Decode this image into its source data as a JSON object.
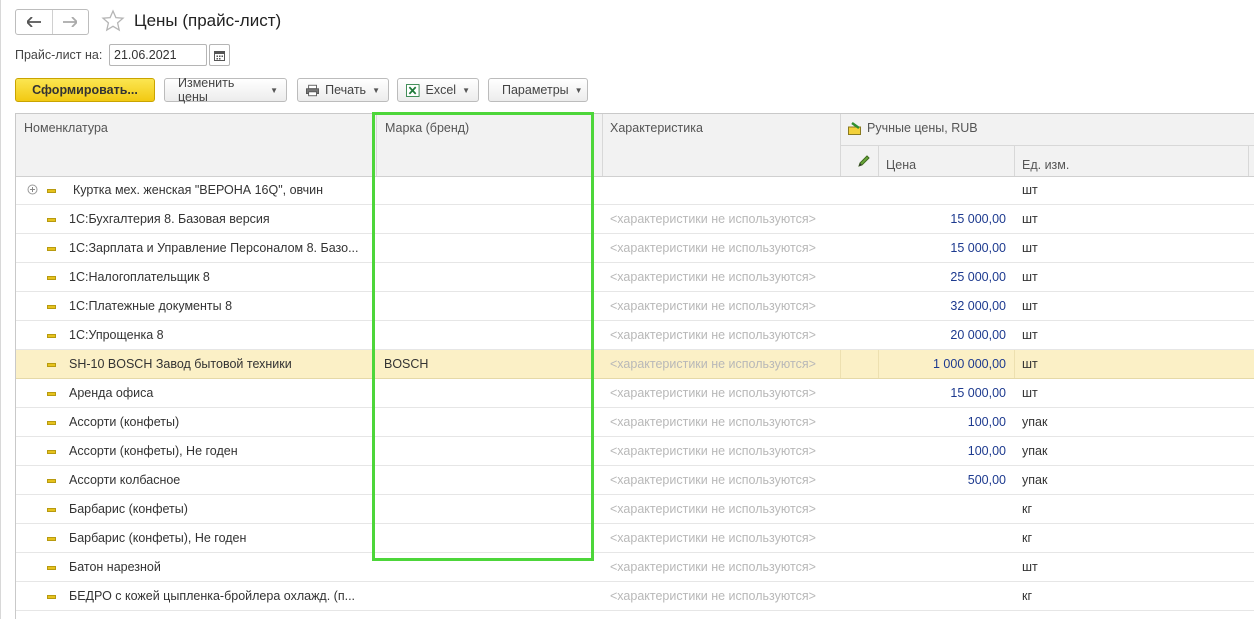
{
  "header": {
    "title": "Цены (прайс-лист)"
  },
  "filter": {
    "date_label": "Прайс-лист на:",
    "date_value": "21.06.2021"
  },
  "toolbar": {
    "generate_label": "Сформировать...",
    "change_prices_label": "Изменить цены",
    "print_label": "Печать",
    "excel_label": "Excel",
    "params_label": "Параметры"
  },
  "table": {
    "columns": {
      "name": "Номенклатура",
      "brand": "Марка (бренд)",
      "characteristic": "Характеристика",
      "manual_prices": "Ручные цены, RUB",
      "price": "Цена",
      "unit": "Ед. изм."
    },
    "rows": [
      {
        "name": "Куртка мех. женская \"ВЕРОНА 16Q\", овчин",
        "brand": "",
        "characteristic": "",
        "price": "",
        "unit": "шт"
      },
      {
        "name": "1С:Бухгалтерия 8. Базовая версия",
        "brand": "",
        "characteristic": "<характеристики не используются>",
        "price": "15 000,00",
        "unit": "шт"
      },
      {
        "name": "1С:Зарплата и Управление Персоналом 8. Базо...",
        "brand": "",
        "characteristic": "<характеристики не используются>",
        "price": "15 000,00",
        "unit": "шт"
      },
      {
        "name": "1С:Налогоплательщик 8",
        "brand": "",
        "characteristic": "<характеристики не используются>",
        "price": "25 000,00",
        "unit": "шт"
      },
      {
        "name": "1С:Платежные документы 8",
        "brand": "",
        "characteristic": "<характеристики не используются>",
        "price": "32 000,00",
        "unit": "шт"
      },
      {
        "name": "1С:Упрощенка 8",
        "brand": "",
        "characteristic": "<характеристики не используются>",
        "price": "20 000,00",
        "unit": "шт"
      },
      {
        "name": "SH-10 BOSCH Завод бытовой техники",
        "brand": "BOSCH",
        "characteristic": "<характеристики не используются>",
        "price": "1 000 000,00",
        "unit": "шт"
      },
      {
        "name": "Аренда офиса",
        "brand": "",
        "characteristic": "<характеристики не используются>",
        "price": "15 000,00",
        "unit": "шт"
      },
      {
        "name": "Ассорти (конфеты)",
        "brand": "",
        "characteristic": "<характеристики не используются>",
        "price": "100,00",
        "unit": "упак"
      },
      {
        "name": "Ассорти (конфеты), Не годен",
        "brand": "",
        "characteristic": "<характеристики не используются>",
        "price": "100,00",
        "unit": "упак"
      },
      {
        "name": "Ассорти колбасное",
        "brand": "",
        "characteristic": "<характеристики не используются>",
        "price": "500,00",
        "unit": "упак"
      },
      {
        "name": "Барбарис (конфеты)",
        "brand": "",
        "characteristic": "<характеристики не используются>",
        "price": "",
        "unit": "кг"
      },
      {
        "name": "Барбарис (конфеты), Не годен",
        "brand": "",
        "characteristic": "<характеристики не используются>",
        "price": "",
        "unit": "кг"
      },
      {
        "name": "Батон нарезной",
        "brand": "",
        "characteristic": "<характеристики не используются>",
        "price": "",
        "unit": "шт"
      },
      {
        "name": "БЕДРО с кожей цыпленка-бройлера охлажд. (п...",
        "brand": "",
        "characteristic": "<характеристики не используются>",
        "price": "",
        "unit": "кг"
      }
    ]
  }
}
